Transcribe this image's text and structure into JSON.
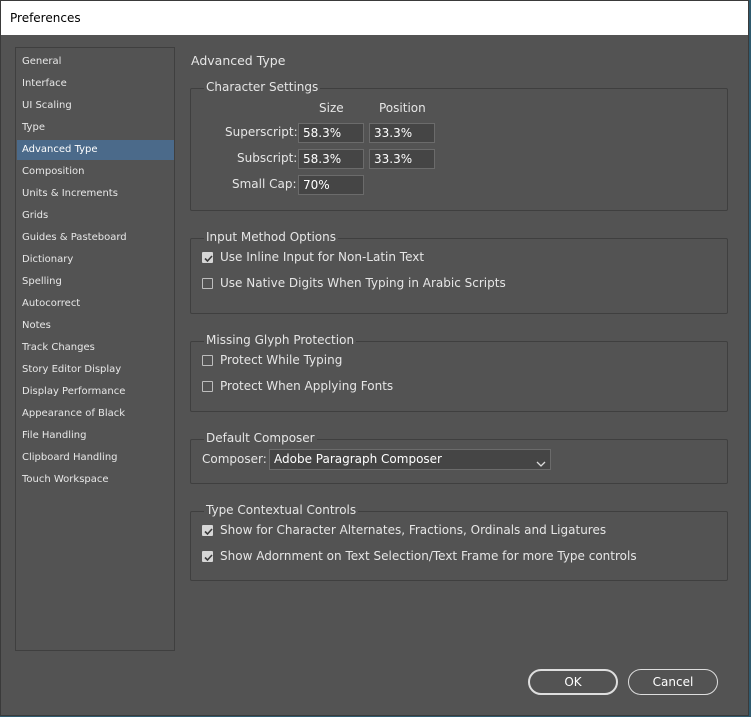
{
  "window": {
    "title": "Preferences"
  },
  "sidebar": {
    "items": [
      {
        "label": "General"
      },
      {
        "label": "Interface"
      },
      {
        "label": "UI Scaling"
      },
      {
        "label": "Type"
      },
      {
        "label": "Advanced Type",
        "selected": true
      },
      {
        "label": "Composition"
      },
      {
        "label": "Units & Increments"
      },
      {
        "label": "Grids"
      },
      {
        "label": "Guides & Pasteboard"
      },
      {
        "label": "Dictionary"
      },
      {
        "label": "Spelling"
      },
      {
        "label": "Autocorrect"
      },
      {
        "label": "Notes"
      },
      {
        "label": "Track Changes"
      },
      {
        "label": "Story Editor Display"
      },
      {
        "label": "Display Performance"
      },
      {
        "label": "Appearance of Black"
      },
      {
        "label": "File Handling"
      },
      {
        "label": "Clipboard Handling"
      },
      {
        "label": "Touch Workspace"
      }
    ]
  },
  "page": {
    "title": "Advanced Type"
  },
  "character_settings": {
    "title": "Character Settings",
    "size_header": "Size",
    "position_header": "Position",
    "superscript_label": "Superscript:",
    "superscript_size": "58.3%",
    "superscript_position": "33.3%",
    "subscript_label": "Subscript:",
    "subscript_size": "58.3%",
    "subscript_position": "33.3%",
    "small_cap_label": "Small Cap:",
    "small_cap_size": "70%"
  },
  "input_method": {
    "title": "Input Method Options",
    "inline_input_label": "Use Inline Input for Non-Latin Text",
    "inline_input_checked": true,
    "native_digits_label": "Use Native Digits When Typing in Arabic Scripts",
    "native_digits_checked": false
  },
  "missing_glyph": {
    "title": "Missing Glyph Protection",
    "while_typing_label": "Protect While Typing",
    "while_typing_checked": false,
    "applying_fonts_label": "Protect When Applying Fonts",
    "applying_fonts_checked": false
  },
  "default_composer": {
    "title": "Default Composer",
    "composer_label": "Composer:",
    "composer_value": "Adobe Paragraph Composer"
  },
  "type_contextual": {
    "title": "Type Contextual Controls",
    "alternates_label": "Show for Character Alternates, Fractions, Ordinals and Ligatures",
    "alternates_checked": true,
    "adornment_label": "Show Adornment on Text Selection/Text Frame for more Type controls",
    "adornment_checked": true
  },
  "buttons": {
    "ok_label": "OK",
    "cancel_label": "Cancel"
  },
  "colors": {
    "panel_bg": "#535353",
    "selected_bg": "#4b6a8a",
    "field_bg": "#454545",
    "text": "#e6e6e6"
  }
}
